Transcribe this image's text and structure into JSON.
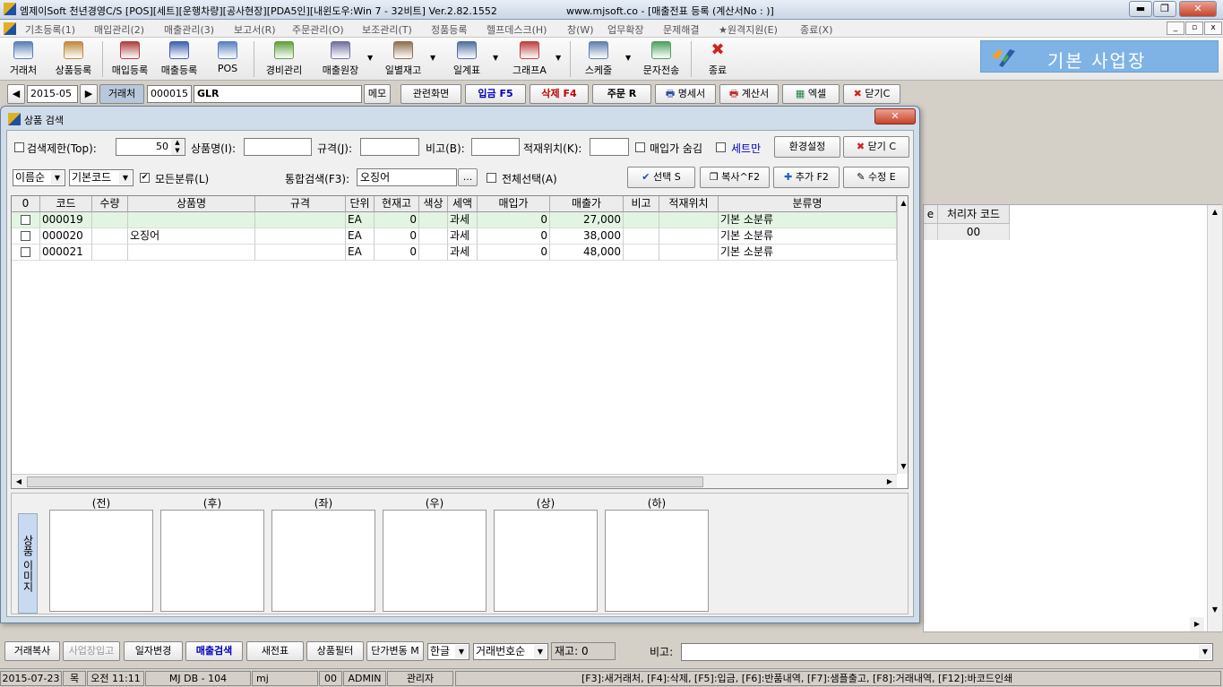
{
  "window": {
    "title": "엠제이Soft 천년경영C/S [POS][세트][운행차량][공사현장][PDA5인][내윈도우:Win 7 - 32비트] Ver.2.82.1552",
    "url_text": "www.mjsoft.co - [매출전표 등록 (계산서No : )]",
    "minimize": "▬",
    "restore": "❐",
    "close": "✕"
  },
  "menu": [
    "기초등록(1)",
    "매입관리(2)",
    "매출관리(3)",
    "보고서(R)",
    "주문관리(O)",
    "보조관리(T)",
    "정품등록",
    "헬프데스크(H)",
    "창(W)",
    "업무확장",
    "문제해결",
    "★원격지원(E)",
    "종료(X)"
  ],
  "mdi": {
    "min": "_",
    "restore": "▫",
    "close": "x"
  },
  "toolbar": [
    {
      "label": "거래처",
      "icon": "people-icon",
      "color": "#5a7fb8"
    },
    {
      "label": "상품등록",
      "icon": "box-icon",
      "color": "#c08a3e"
    },
    {
      "label": "매입등록",
      "icon": "purchase-icon",
      "color": "#b04040"
    },
    {
      "label": "매출등록",
      "icon": "sales-icon",
      "color": "#4060b0"
    },
    {
      "label": "POS",
      "icon": "pos-icon",
      "color": "#5a80c0"
    },
    {
      "label": "경비관리",
      "icon": "money-icon",
      "color": "#60a040"
    },
    {
      "label": "매출원장",
      "icon": "ledger-icon",
      "color": "#7070a0"
    },
    {
      "label": "일별재고",
      "icon": "calendar-icon",
      "color": "#907050"
    },
    {
      "label": "일계표",
      "icon": "daily-report-icon",
      "color": "#5070a0"
    },
    {
      "label": "그래프A",
      "icon": "chart-icon",
      "color": "#c04040"
    },
    {
      "label": "스케줄",
      "icon": "schedule-icon",
      "color": "#6080b0"
    },
    {
      "label": "문자전송",
      "icon": "sms-icon",
      "color": "#50a060"
    },
    {
      "label": "종료",
      "icon": "exit-icon",
      "color": "#d02020"
    }
  ],
  "brand": {
    "text": "기본 사업장",
    "bg": "#7fb3e6"
  },
  "nav": {
    "prev": "◀",
    "month": "2015-05",
    "next": "▶",
    "customer_label": "거래처",
    "customer_code": "000015",
    "customer_name": "GLR",
    "memo": "메모",
    "related": "관련화면",
    "deposit": "입금 F5",
    "delete": "삭제 F4",
    "order": "주문 R",
    "statement": "명세서",
    "invoice": "계산서",
    "excel": "엑셀",
    "close": "닫기C"
  },
  "background_table": {
    "headers": [
      "e",
      "처리자 코드"
    ],
    "values": [
      "",
      "00"
    ]
  },
  "dialog": {
    "title": "상품 검색",
    "close": "✕",
    "search_limit_label": "검색제한(Top):",
    "search_limit_value": "50",
    "product_name_label": "상품명(I):",
    "product_name_value": "",
    "spec_label": "규격(J):",
    "spec_value": "",
    "note_label": "비고(B):",
    "note_value": "",
    "location_label": "적재위치(K):",
    "location_value": "",
    "hide_purchase_label": "매입가 숨김",
    "set_only_label": "세트만",
    "env_settings": "환경설정",
    "close_btn": "닫기 C",
    "sort_select": "이름순",
    "code_select": "기본코드",
    "all_categories_label": "모든분류(L)",
    "integrated_search_label": "통합검색(F3):",
    "integrated_search_value": "오징어",
    "ellipsis": "...",
    "select_all_label": "전체선택(A)",
    "select_btn": "선택 S",
    "copy_btn": "복사^F2",
    "add_btn": "추가 F2",
    "edit_btn": "수정 E",
    "grid": {
      "headers": [
        "0",
        "코드",
        "수량",
        "상품명",
        "규격",
        "단위",
        "현재고",
        "색상",
        "세액",
        "매입가",
        "매출가",
        "비고",
        "적재위치",
        "분류명"
      ],
      "rows": [
        {
          "code": "000019",
          "qty": "",
          "name": "",
          "spec": "",
          "unit": "EA",
          "stock": "0",
          "color": "",
          "tax": "과세",
          "purchase": "0",
          "sale": "27,000",
          "note": "",
          "location": "",
          "category": "기본 소분류"
        },
        {
          "code": "000020",
          "qty": "",
          "name": "오징어",
          "spec": "",
          "unit": "EA",
          "stock": "0",
          "color": "",
          "tax": "과세",
          "purchase": "0",
          "sale": "38,000",
          "note": "",
          "location": "",
          "category": "기본 소분류"
        },
        {
          "code": "000021",
          "qty": "",
          "name": "",
          "spec": "",
          "unit": "EA",
          "stock": "0",
          "color": "",
          "tax": "과세",
          "purchase": "0",
          "sale": "48,000",
          "note": "",
          "location": "",
          "category": "기본 소분류"
        }
      ]
    },
    "image_labels": [
      "(전)",
      "(후)",
      "(좌)",
      "(우)",
      "(상)",
      "(하)"
    ],
    "image_side_label": "상품 이미지"
  },
  "bottom": {
    "copy_trade": "거래복사",
    "store_in": "사업장입고",
    "date_change": "일자변경",
    "sales_search": "매출검색",
    "new_slip": "새전표",
    "product_filter": "상품필터",
    "price_change": "단가변동 M",
    "lang": "한글",
    "trade_order": "거래번호순",
    "stock_label": "재고: 0",
    "note_label": "비고:",
    "note_value": ""
  },
  "status": {
    "date": "2015-07-23",
    "weekday": "목",
    "time": "오전 11:11",
    "db": "MJ DB - 104",
    "user_id": "mj",
    "code": "00",
    "user": "ADMIN",
    "role": "관리자",
    "hotkeys": "[F3]:새거래처, [F4]:삭제, [F5]:입금, [F6]:반품내역, [F7]:샘플출고, [F8]:거래내역, [F12]:바코드인쇄"
  }
}
